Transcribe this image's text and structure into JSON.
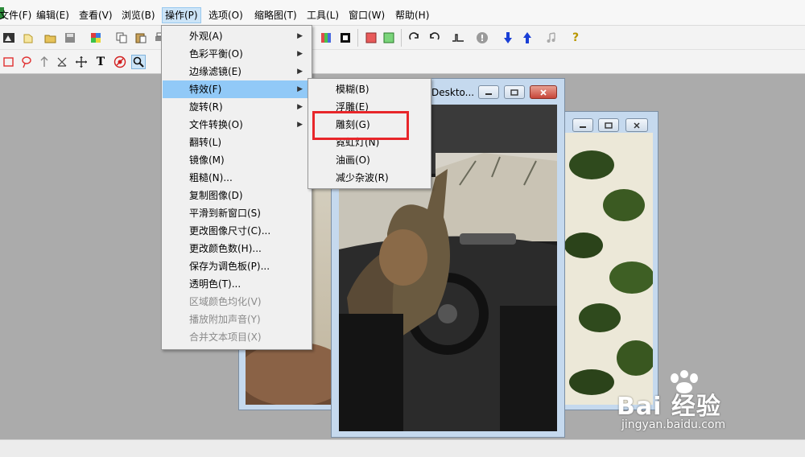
{
  "menubar": {
    "items": [
      "文件(F)",
      "编辑(E)",
      "查看(V)",
      "浏览(B)",
      "操作(P)",
      "选项(O)",
      "缩略图(T)",
      "工具(L)",
      "窗口(W)",
      "帮助(H)"
    ]
  },
  "operations_menu": {
    "items": [
      {
        "label": "外观(A)"
      },
      {
        "label": "色彩平衡(O)"
      },
      {
        "label": "边缘滤镜(E)"
      },
      {
        "label": "特效(F)"
      },
      {
        "label": "旋转(R)"
      },
      {
        "label": "文件转换(O)"
      },
      {
        "label": "翻转(L)"
      },
      {
        "label": "镜像(M)"
      },
      {
        "label": "粗糙(N)..."
      },
      {
        "label": "复制图像(D)"
      },
      {
        "label": "平滑到新窗口(S)"
      },
      {
        "label": "更改图像尺寸(C)..."
      },
      {
        "label": "更改颜色数(H)..."
      },
      {
        "label": "保存为调色板(P)..."
      },
      {
        "label": "透明色(T)..."
      },
      {
        "label": "区域颜色均化(V)"
      },
      {
        "label": "播放附加声音(Y)"
      },
      {
        "label": "合并文本项目(X)"
      }
    ]
  },
  "effects_submenu": {
    "items": [
      {
        "label": "模糊(B)"
      },
      {
        "label": "浮雕(E)"
      },
      {
        "label": "雕刻(G)"
      },
      {
        "label": "霓虹灯(N)"
      },
      {
        "label": "油画(O)"
      },
      {
        "label": "减少杂波(R)"
      }
    ]
  },
  "front_window": {
    "title": "Deskto..."
  },
  "toolbar": {
    "text_tool_glyph": "T",
    "help_glyph": "?"
  },
  "watermark": {
    "logo": "Bai 经验",
    "url": "jingyan.baidu.com"
  },
  "colors": {
    "menu_highlight": "#91c9f7",
    "active_menu": "#cce4f7",
    "red_box": "#e8262a",
    "workspace": "#ababab"
  }
}
